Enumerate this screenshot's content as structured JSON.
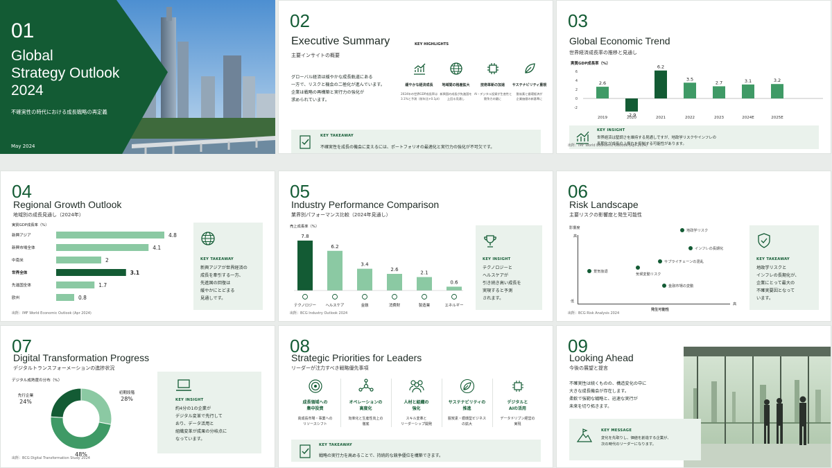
{
  "colors": {
    "dark": "#135b34",
    "mid": "#3f9a66",
    "light": "#8bc9a3",
    "pale": "#eaf2ec"
  },
  "s1": {
    "num": "01",
    "title_lines": [
      "Global",
      "Strategy Outlook",
      "2024"
    ],
    "subtitle": "不確実性の時代における成長戦略の再定義",
    "date": "May 2024"
  },
  "s2": {
    "num": "02",
    "title": "Executive Summary",
    "subtitle": "主要インサイトの概要",
    "body": [
      "グローバル経済は緩やかな成長軌道にある",
      "一方で、リスクと機会の二極化が進んでいます。",
      "企業は戦略の再構築と実行力の強化が",
      "求められています。"
    ],
    "highlights_label": "KEY HIGHLIGHTS",
    "highlights": [
      {
        "icon": "chart-up-icon",
        "title": "緩やかな経済成長",
        "lines": [
          "2024年の世界GDP成長率は",
          "3.1%と予測（前年比+0.1pt）"
        ]
      },
      {
        "icon": "globe-icon",
        "title": "地域間の格差拡大",
        "lines": [
          "新興国の成長が先進国を",
          "上回る見通し"
        ]
      },
      {
        "icon": "chip-icon",
        "title": "技術革新の加速",
        "lines": [
          "AI・デジタル投資が生産性と",
          "競争力の鍵に"
        ]
      },
      {
        "icon": "leaf-icon",
        "title": "サステナビリティ重視",
        "lines": [
          "脱炭素と循環経済が",
          "企業価値の新基準に"
        ]
      }
    ],
    "takeaway_label": "KEY TAKEAWAY",
    "takeaway": "不確実性を成長の機会に変えるには、ポートフォリオの最適化と実行力の強化が不可欠です。"
  },
  "s3": {
    "num": "03",
    "title": "Global Economic Trend",
    "subtitle": "世界経済成長率の推移と見通し",
    "insight_label": "KEY INSIGHT",
    "insight": [
      "世界経済は堅調さを維持する見通しですが、地政学リスクやインフレの",
      "長期化が成長の上振れを抑制する可能性があります。"
    ],
    "source": "出所：IMF World Economic Outlook (Apr 2024)"
  },
  "s4": {
    "num": "04",
    "title": "Regional Growth Outlook",
    "subtitle": "地域別の成長見通し（2024年）",
    "takeaway_label": "KEY TAKEAWAY",
    "takeaway": [
      "新興アジアが世界経済の",
      "成長を牽引する一方、",
      "先進国の回復は",
      "緩やかにとどまる",
      "見通しです。"
    ],
    "source": "出所：IMF World Economic Outlook (Apr 2024)"
  },
  "s5": {
    "num": "05",
    "title": "Industry Performance Comparison",
    "subtitle": "業界別パフォーマンス比較（2024年見通し）",
    "insight_label": "KEY INSIGHT",
    "insight": [
      "テクノロジーと",
      "ヘルスケアが",
      "引き続き高い成長を",
      "実現すると予測",
      "されます。"
    ],
    "source": "出所：BCG Industry Outlook 2024"
  },
  "s6": {
    "num": "06",
    "title": "Risk Landscape",
    "subtitle": "主要リスクの影響度と発生可能性",
    "risks": [
      "地政学リスク",
      "インフレの長期化",
      "サプライチェーンの混乱",
      "景気後退",
      "気候変動リスク",
      "金融市場の変動"
    ],
    "ylabel": "影響度",
    "xlabel": "発生可能性",
    "high": "高",
    "low": "低",
    "high_x": "高",
    "takeaway_label": "KEY TAKEAWAY",
    "takeaway": [
      "地政学リスクと",
      "インフレの長期化が、",
      "企業にとって最大の",
      "不確実要因となって",
      "います。"
    ],
    "source": "出所：BCG Risk Analysis 2024"
  },
  "s7": {
    "num": "07",
    "title": "Digital Transformation Progress",
    "subtitle": "デジタルトランスフォーメーションの進捗状況",
    "insight_label": "KEY INSIGHT",
    "insight": [
      "約4分の1の企業が",
      "デジタル変革で先行して",
      "おり、データ活用と",
      "組織変革が成果の分岐点に",
      "なっています。"
    ],
    "source": "出所：BCG Digital Transformation Study 2024"
  },
  "s8": {
    "num": "08",
    "title": "Strategic Priorities for Leaders",
    "subtitle": "リーダーが注力すべき戦略優先事項",
    "items": [
      {
        "icon": "target-icon",
        "title": [
          "成長領域への",
          "集中投資"
        ],
        "desc": [
          "高成長市場・事業への",
          "リソースシフト"
        ]
      },
      {
        "icon": "network-icon",
        "title": [
          "オペレーションの",
          "高度化"
        ],
        "desc": [
          "効率化と生産性向上の",
          "徹底"
        ]
      },
      {
        "icon": "people-icon",
        "title": [
          "人材と組織の",
          "強化"
        ],
        "desc": [
          "スキル変革と",
          "リーダーシップ開発"
        ]
      },
      {
        "icon": "leaf-icon",
        "title": [
          "サステナビリティの",
          "推進"
        ],
        "desc": [
          "脱炭素・循環型ビジネス",
          "の拡大"
        ]
      },
      {
        "icon": "chip-icon",
        "title": [
          "デジタルと",
          "AIの活用"
        ],
        "desc": [
          "データドリブン経営の",
          "実現"
        ]
      }
    ],
    "takeaway_label": "KEY TAKEAWAY",
    "takeaway": "戦略の実行力を高めることで、持続的な競争優位を構築できます。"
  },
  "s9": {
    "num": "09",
    "title": "Looking Ahead",
    "subtitle": "今後の展望と提言",
    "body": [
      "不確実性は続くものの、構造変化の中に",
      "大きな成長機会が存在します。",
      "柔軟で強靭な戦略と、迅速な実行が",
      "未来を切り拓きます。"
    ],
    "msg_label": "KEY MESSAGE",
    "msg": [
      "変化を先取りし、価値を創造する企業が、",
      "次の時代のリーダーになります。"
    ]
  },
  "chart_data": [
    {
      "type": "bar",
      "title": "",
      "ylabel": "実質GDP成長率（%）",
      "categories": [
        "2019",
        "2020",
        "2021",
        "2022",
        "2023",
        "2024E",
        "2025E"
      ],
      "values": [
        2.6,
        -2.9,
        6.2,
        3.5,
        2.7,
        3.1,
        3.2
      ],
      "ylim": [
        -2,
        6
      ],
      "yticks": [
        "6",
        "4",
        "2",
        "0",
        "-2"
      ]
    },
    {
      "type": "bar",
      "orientation": "horizontal",
      "title": "",
      "ylabel": "実質GDP成長率（%）",
      "categories": [
        "新興アジア",
        "新興市場全体",
        "中南米",
        "世界全体",
        "先進国全体",
        "欧州"
      ],
      "values": [
        4.8,
        4.1,
        2.0,
        3.1,
        1.7,
        0.8
      ],
      "highlight": "世界全体"
    },
    {
      "type": "bar",
      "title": "",
      "ylabel": "売上成長率（%）",
      "categories": [
        "テクノロジー",
        "ヘルスケア",
        "金融",
        "消費財",
        "製造業",
        "エネルギー"
      ],
      "values": [
        7.8,
        6.2,
        3.4,
        2.6,
        2.1,
        0.6
      ]
    },
    {
      "type": "pie",
      "title": "",
      "label": "デジタル成熟度の分布（%）",
      "categories": [
        "先行企業",
        "初期段階",
        ""
      ],
      "values": [
        24,
        28,
        48
      ]
    }
  ]
}
